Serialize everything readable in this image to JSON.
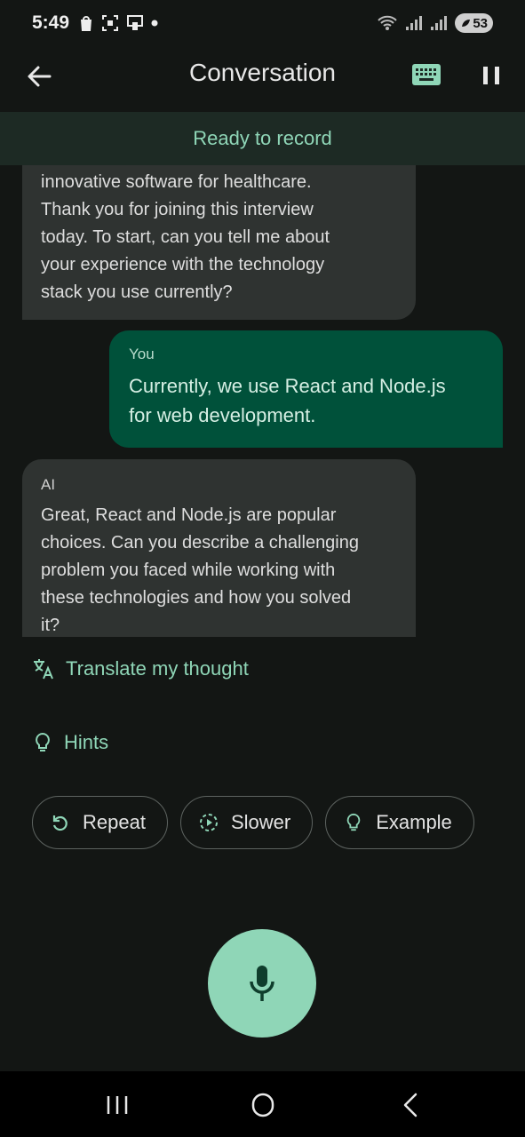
{
  "status_bar": {
    "time": "5:49",
    "battery": "53",
    "icons": [
      "shopping-bag-icon",
      "screenshot-icon",
      "cast-icon",
      "dot-icon",
      "wifi-icon",
      "signal-icon",
      "signal-icon"
    ]
  },
  "app_bar": {
    "title": "Conversation",
    "back_icon": "arrow-back-icon",
    "keyboard_icon": "keyboard-icon",
    "pause_icon": "pause-icon",
    "accent": "#8fd6b7"
  },
  "banner": {
    "text": "Ready to record"
  },
  "messages": [
    {
      "role": "ai",
      "lines": [
        "innovative software for healthcare.",
        "Thank you for joining this interview",
        "today. To start, can you tell me about",
        "your experience with the technology",
        "stack you use currently?"
      ]
    },
    {
      "role": "you",
      "sender": "You",
      "lines": [
        "Currently, we use React and Node.js",
        "for web development."
      ]
    },
    {
      "role": "ai",
      "sender": "AI",
      "lines": [
        "Great, React and Node.js are popular",
        "choices. Can you describe a challenging",
        "problem you faced while working with",
        "these technologies and how you solved",
        "it?"
      ]
    }
  ],
  "translate": {
    "label": "Translate my thought",
    "icon": "translate-icon"
  },
  "hints": {
    "label": "Hints",
    "icon": "lightbulb-icon"
  },
  "chips": [
    {
      "label": "Repeat",
      "icon": "replay-icon"
    },
    {
      "label": "Slower",
      "icon": "slow-motion-icon"
    },
    {
      "label": "Example",
      "icon": "lightbulb-icon"
    }
  ],
  "mic": {
    "icon": "microphone-icon",
    "color": "#8fd6b7"
  },
  "nav_bar": {
    "icons": [
      "recents-icon",
      "home-icon",
      "back-icon"
    ]
  }
}
